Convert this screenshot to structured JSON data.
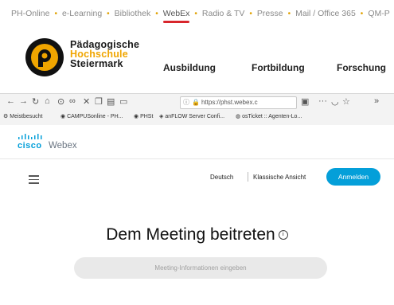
{
  "top_nav": {
    "items": [
      "PH-Online",
      "e-Learning",
      "Bibliothek",
      "WebEx",
      "Radio & TV",
      "Presse",
      "Mail / Office 365",
      "QM-P"
    ],
    "active": "WebEx"
  },
  "brand": {
    "line1": "Pädagogische",
    "line2": "Hochschule",
    "line3": "Steiermark"
  },
  "main_nav": [
    "Ausbildung",
    "Fortbildung",
    "Forschung"
  ],
  "browser": {
    "url": "https://phst.webex.c",
    "bookmarks": [
      "Meistbesucht",
      "CAMPUSonline - PH...",
      "PHSt",
      "anFLOW Server Confi...",
      "osTicket :: Agenten-Lo..."
    ]
  },
  "webex": {
    "cisco": "cisco",
    "brand": "Webex",
    "lang": "Deutsch",
    "classic": "Klassische Ansicht",
    "signin": "Anmelden",
    "title": "Dem Meeting beitreten",
    "input_placeholder": "Meeting-Informationen eingeben"
  },
  "colors": {
    "accent": "#f0a500",
    "active_underline": "#d8262c",
    "webex_blue": "#049fd9"
  }
}
